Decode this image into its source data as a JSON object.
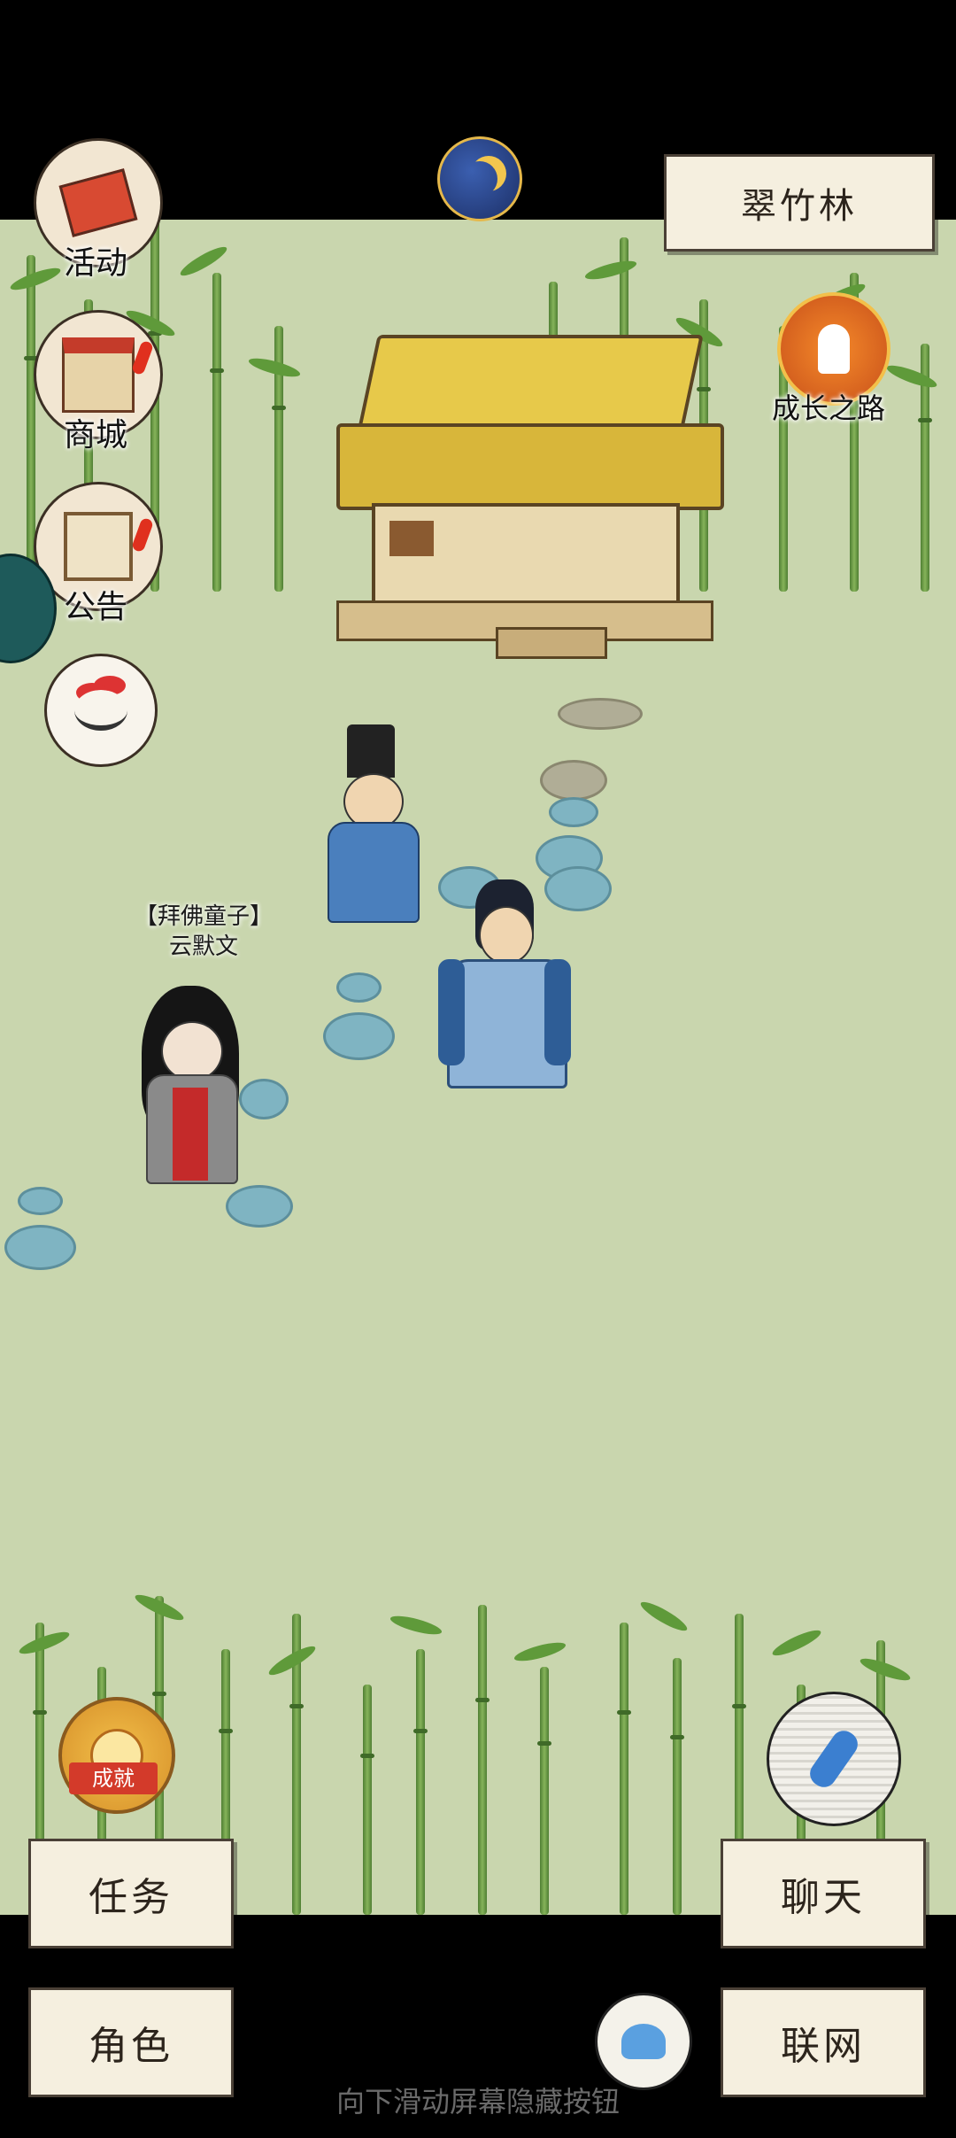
{
  "location": {
    "name": "翠竹林"
  },
  "left_menu": {
    "activity_label": "活动",
    "shop_label": "商城",
    "notice_label": "公告"
  },
  "growth": {
    "label": "成长之路"
  },
  "npc": {
    "title": "【拜佛童子】",
    "name": "云默文"
  },
  "achievement": {
    "label": "成就"
  },
  "bottom_buttons": {
    "task": "任务",
    "role": "角色",
    "chat": "聊天",
    "network": "联网"
  },
  "hint": "向下滑动屏幕隐藏按钮",
  "colors": {
    "accent_orange": "#e8751f",
    "button_bg": "#f5efdf",
    "scene_bg": "#c9d6ae",
    "alert_red": "#e0301e"
  }
}
